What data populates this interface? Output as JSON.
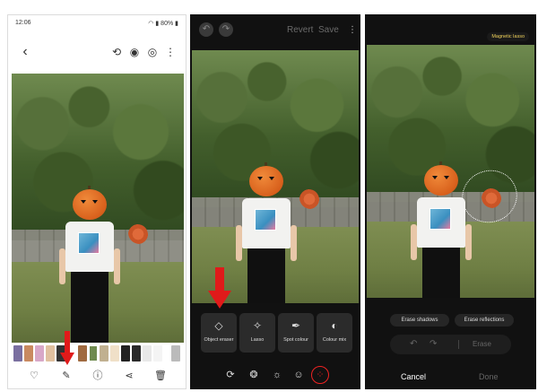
{
  "screen1": {
    "status_time": "12:06",
    "status_battery": "80%",
    "toolbar_icons": [
      "back-icon",
      "rotate-icon",
      "eye-icon",
      "cast-icon",
      "more-icon"
    ],
    "bottom_icons": [
      "heart-icon",
      "edit-pencil-icon",
      "info-icon",
      "share-icon",
      "trash-icon"
    ],
    "back_glyph": "‹",
    "more_glyph": "⋮"
  },
  "screen2": {
    "revert_label": "Revert",
    "save_label": "Save",
    "more_glyph": "⋮",
    "tools": [
      {
        "icon": "object-eraser-icon",
        "label": "Object eraser"
      },
      {
        "icon": "lasso-icon",
        "label": "Lasso"
      },
      {
        "icon": "spot-colour-icon",
        "label": "Spot colour"
      },
      {
        "icon": "colour-mix-icon",
        "label": "Colour mix"
      }
    ],
    "bottom_icons": [
      "crop-rotate-icon",
      "filter-icon",
      "adjust-icon",
      "sticker-icon",
      "more-tools-icon"
    ]
  },
  "screen3": {
    "badge_label": "Magnetic lasso",
    "erase_shadows_label": "Erase shadows",
    "erase_reflections_label": "Erase reflections",
    "erase_label": "Erase",
    "cancel_label": "Cancel",
    "done_label": "Done"
  },
  "colors": {
    "arrow": "#e01a1a",
    "dark_panel": "#111111",
    "badge_text": "#f0d25a"
  }
}
